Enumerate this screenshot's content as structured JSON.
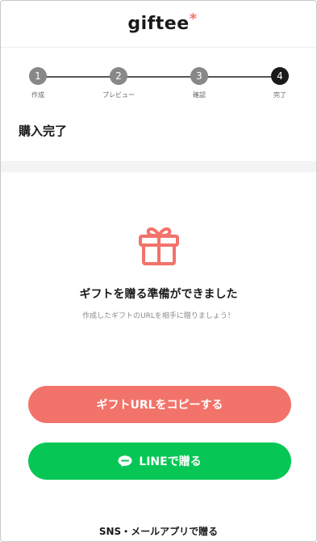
{
  "header": {
    "logo": "giftee",
    "logo_mark": "*"
  },
  "steps": [
    {
      "num": "1",
      "label": "作成"
    },
    {
      "num": "2",
      "label": "プレビュー"
    },
    {
      "num": "3",
      "label": "確認"
    },
    {
      "num": "4",
      "label": "完了"
    }
  ],
  "page": {
    "title": "購入完了"
  },
  "completion": {
    "icon": "gift-icon",
    "title": "ギフトを贈る準備ができました",
    "subtitle": "作成したギフトのURLを相手に贈りましょう！"
  },
  "actions": {
    "copy_label": "ギフトURLをコピーする",
    "line_label": "LINEで贈る",
    "sns_label": "SNS・メールアプリで贈る"
  },
  "colors": {
    "accent": "#f2736a",
    "line_green": "#06c755",
    "active_step": "#1a1a1a",
    "inactive_step": "#888888"
  }
}
